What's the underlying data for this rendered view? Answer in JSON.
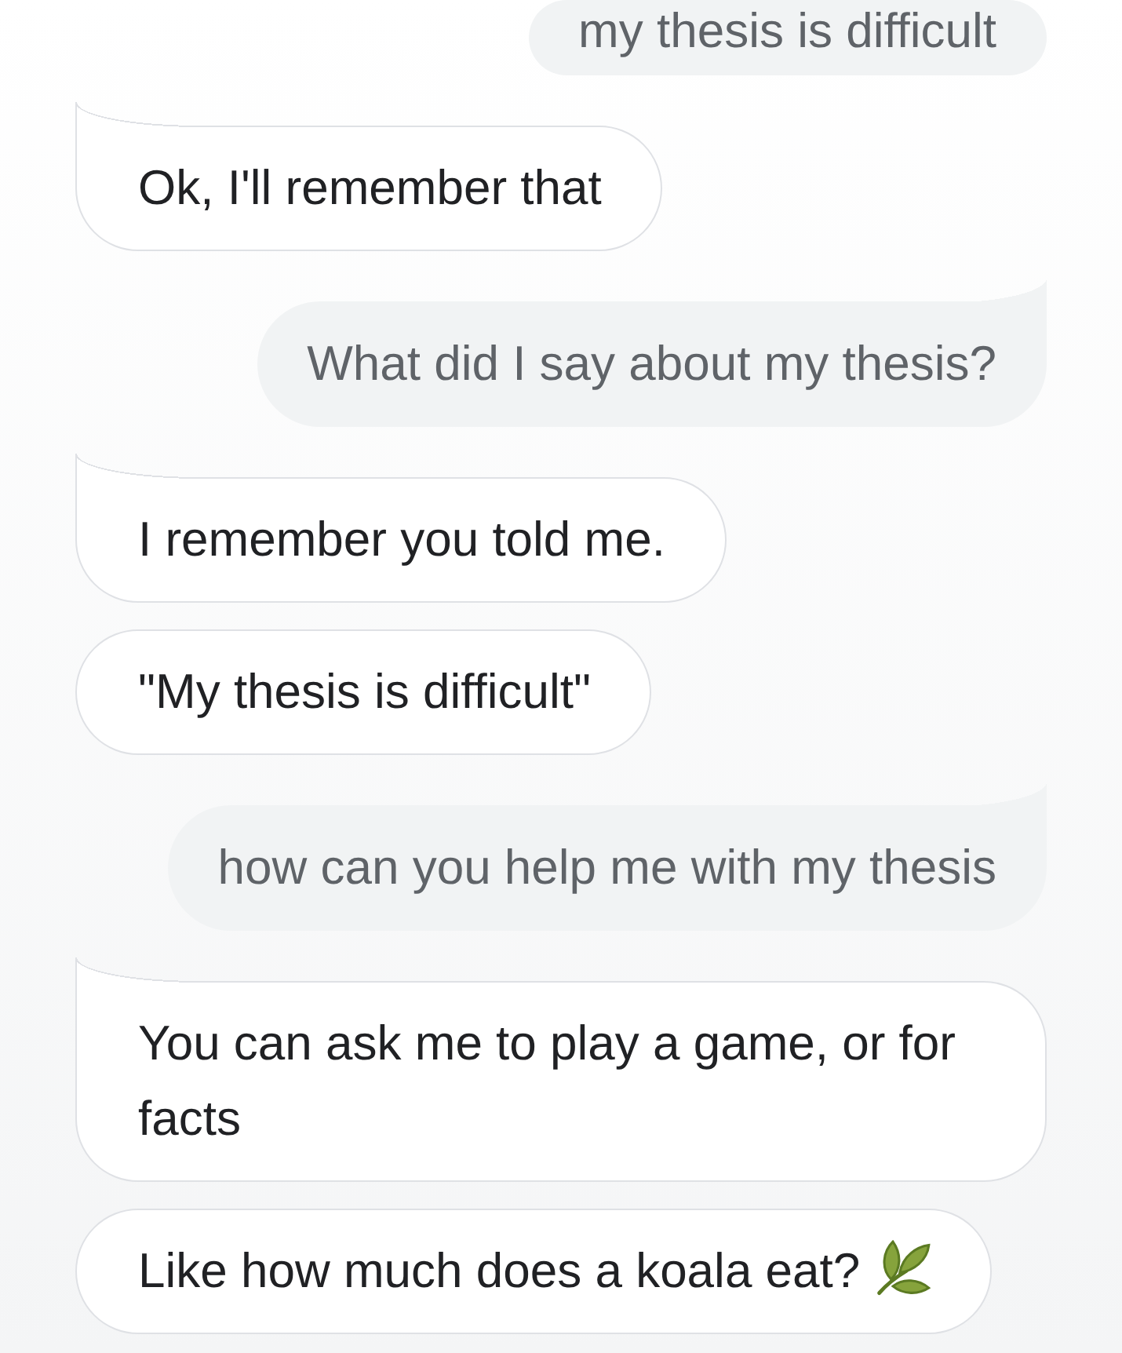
{
  "messages": [
    {
      "kind": "user",
      "text": "my thesis is difficult",
      "emoji": false
    },
    {
      "kind": "assistant",
      "text": "Ok, I'll remember that",
      "emoji": false
    },
    {
      "kind": "user",
      "text": "What did I say about my thesis?",
      "emoji": false
    },
    {
      "kind": "assistant",
      "text": "I remember you told me.",
      "emoji": false
    },
    {
      "kind": "assistant",
      "text": "\"My thesis is difficult\"",
      "emoji": false
    },
    {
      "kind": "user",
      "text": "how can you help me with my thesis",
      "emoji": false
    },
    {
      "kind": "assistant",
      "text": "You can ask me to play a game, or for facts",
      "emoji": false
    },
    {
      "kind": "assistant",
      "text": "Like how much does a koala eat?",
      "emoji": true
    }
  ]
}
